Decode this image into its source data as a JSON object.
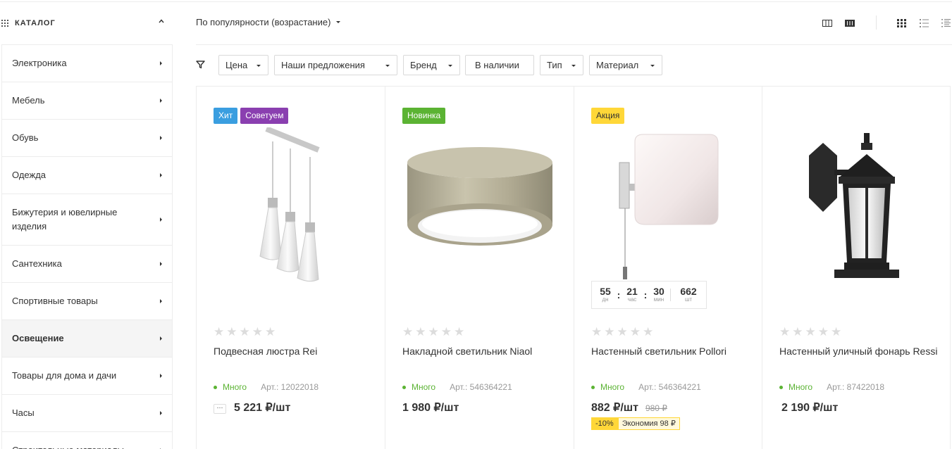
{
  "catalog": {
    "title": "КАТАЛОГ",
    "items": [
      {
        "label": "Электроника"
      },
      {
        "label": "Мебель"
      },
      {
        "label": "Обувь"
      },
      {
        "label": "Одежда"
      },
      {
        "label": "Бижутерия и ювелирные изделия"
      },
      {
        "label": "Сантехника"
      },
      {
        "label": "Спортивные товары"
      },
      {
        "label": "Освещение",
        "active": true
      },
      {
        "label": "Товары для дома и дачи"
      },
      {
        "label": "Часы"
      },
      {
        "label": "Строительные материалы"
      }
    ]
  },
  "toolbar": {
    "sort_label": "По популярности (возрастание)",
    "view_icons": [
      "view-2col-icon",
      "view-3col-icon",
      "grid-view-icon",
      "list-view-icon",
      "compact-list-icon"
    ]
  },
  "filters": [
    {
      "label": "Цена"
    },
    {
      "label": "Наши предложения"
    },
    {
      "label": "Бренд"
    },
    {
      "label": "В наличии"
    },
    {
      "label": "Тип"
    },
    {
      "label": "Материал"
    }
  ],
  "products": [
    {
      "badges": [
        {
          "label": "Хит",
          "color": "#3a9ee0"
        },
        {
          "label": "Советуем",
          "color": "#8a3fb0"
        }
      ],
      "name": "Подвесная люстра Rei",
      "stock": "Много",
      "article": "Арт.: 12022018",
      "price": "5 221 ₽/шт",
      "more": "···",
      "image": "pendant-chandelier"
    },
    {
      "badges": [
        {
          "label": "Новинка",
          "color": "#5bb333"
        }
      ],
      "name": "Накладной светильник Niaol",
      "stock": "Много",
      "article": "Арт.: 546364221",
      "price": "1 980 ₽/шт",
      "image": "ceiling-light"
    },
    {
      "badges": [
        {
          "label": "Акция",
          "color": "#ffd738",
          "text_color": "#333"
        }
      ],
      "name": "Настенный светильник Pollori",
      "stock": "Много",
      "article": "Арт.: 546364221",
      "price": "882 ₽/шт",
      "old_price": "980 ₽",
      "discount": "-10%",
      "saving": "Экономия 98 ₽",
      "timer": {
        "days": "55",
        "days_label": "дн",
        "hours": "21",
        "hours_label": "час",
        "minutes": "30",
        "minutes_label": "мин",
        "qty": "662",
        "qty_label": "шт"
      },
      "image": "wall-sconce"
    },
    {
      "badges": [],
      "name": "Настенный уличный фонарь Ressi",
      "stock": "Много",
      "article": "Арт.: 87422018",
      "price": "2 190 ₽/шт",
      "image": "outdoor-lantern"
    }
  ]
}
